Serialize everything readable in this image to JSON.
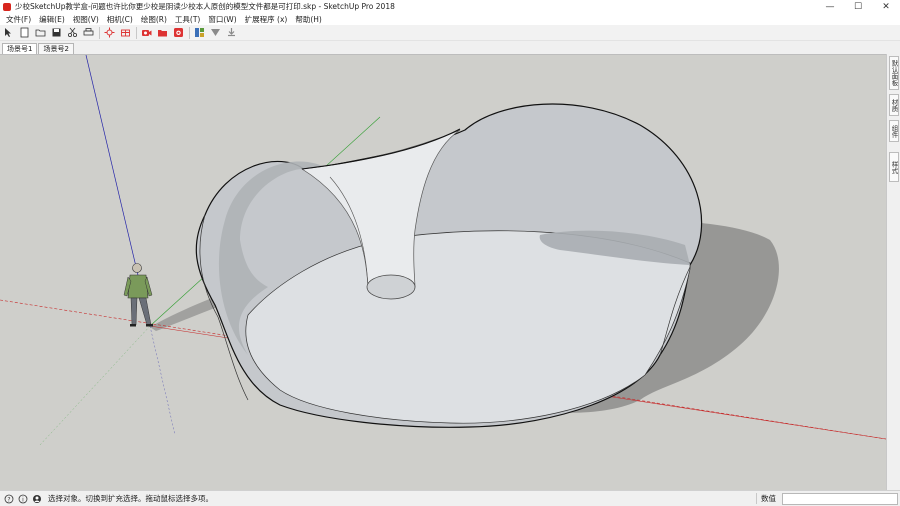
{
  "window": {
    "title": "少校SketchUp教学盒-问题也许比你更少校是阴读少校本人原创的模型文件都是可打印.skp - SketchUp Pro 2018",
    "minimize_glyph": "—",
    "maximize_glyph": "☐",
    "close_glyph": "✕"
  },
  "menu": {
    "items": [
      {
        "label": "文件(F)"
      },
      {
        "label": "编辑(E)"
      },
      {
        "label": "视图(V)"
      },
      {
        "label": "相机(C)"
      },
      {
        "label": "绘图(R)"
      },
      {
        "label": "工具(T)"
      },
      {
        "label": "窗口(W)"
      },
      {
        "label": "扩展程序 (x)"
      },
      {
        "label": "帮助(H)"
      }
    ]
  },
  "toolbar": {
    "icons": [
      "select-icon",
      "new-file-icon",
      "open-file-icon",
      "save-icon",
      "cut-icon",
      "print-icon",
      "component-icon",
      "paint-icon",
      "camera-icon",
      "shadow-icon",
      "photo-icon",
      "layers-icon",
      "style-icon",
      "export-icon"
    ]
  },
  "scenes": {
    "tabs": [
      {
        "label": "场景号1"
      },
      {
        "label": "场景号2"
      }
    ]
  },
  "side_panel": {
    "tabs": [
      {
        "label": "默认面板"
      },
      {
        "label": "材质"
      },
      {
        "label": "组件"
      },
      {
        "label": "样式"
      }
    ]
  },
  "status": {
    "message": "选择对象。切换到扩充选择。拖动鼠标选择多项。",
    "measurements_label": "数值",
    "measurements_value": ""
  },
  "colors": {
    "viewport_bg": "#cfcfcb",
    "red_axis": "#c62828",
    "green_axis": "#2e9d2e",
    "blue_axis": "#2222aa",
    "model_fill": "#c8cbcf",
    "shadow": "#8a8a8a"
  }
}
